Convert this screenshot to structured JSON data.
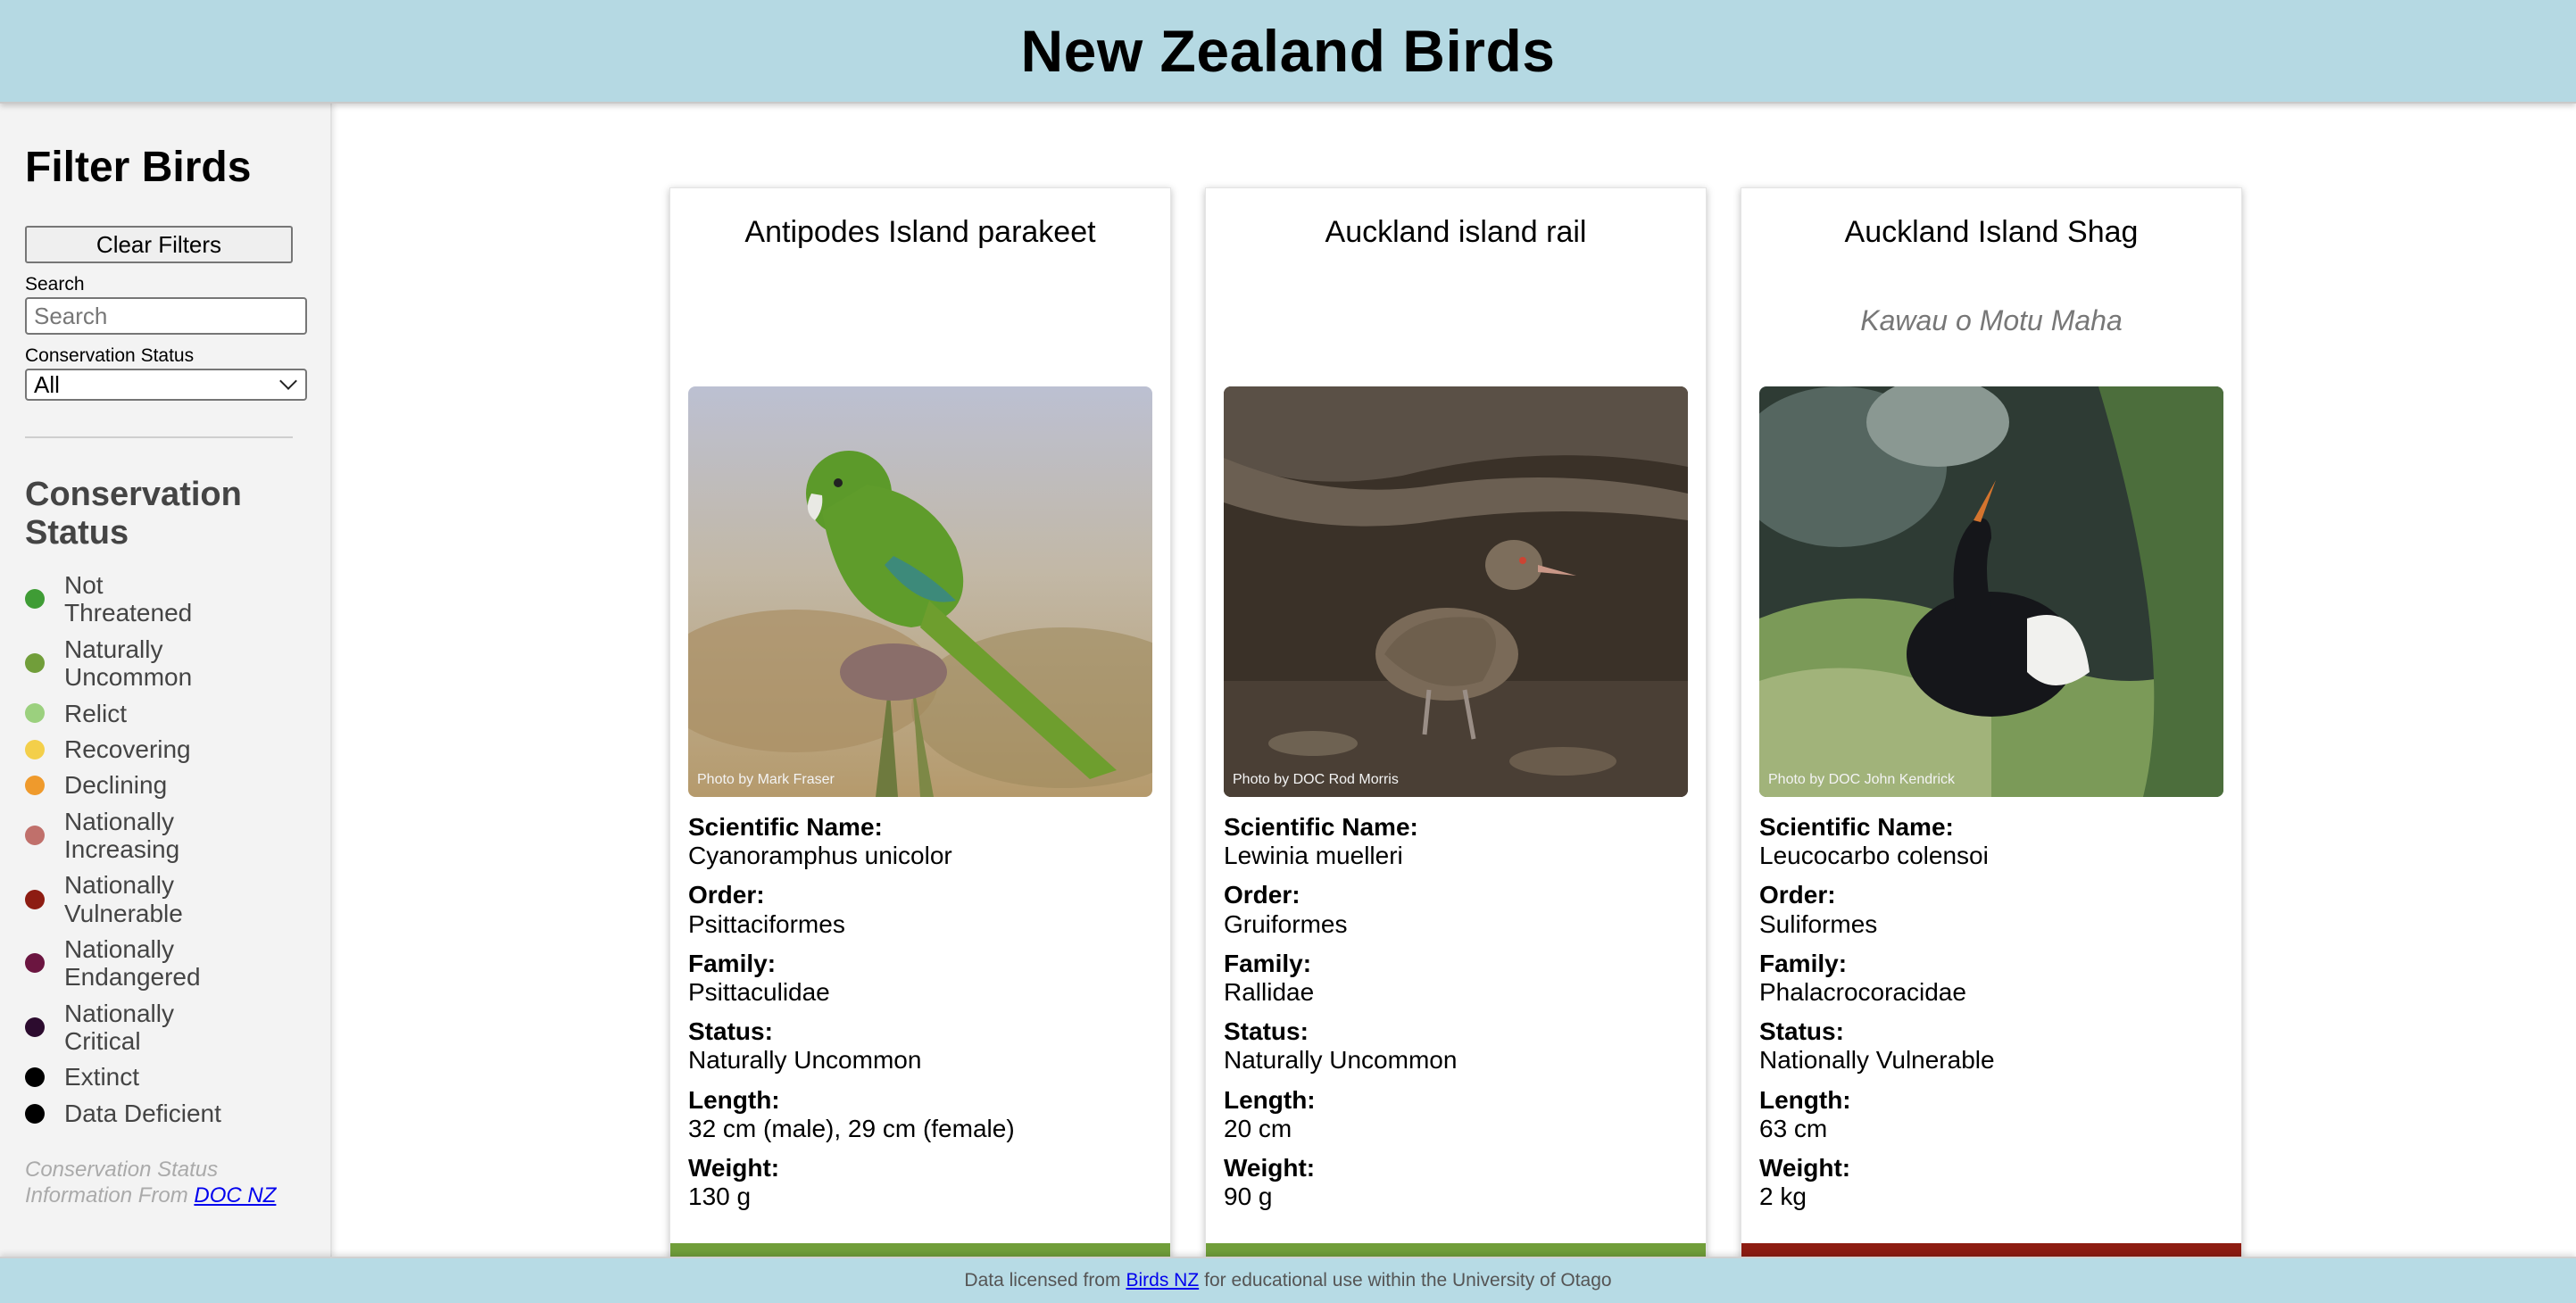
{
  "header": {
    "title": "New Zealand Birds"
  },
  "sidebar": {
    "title": "Filter Birds",
    "clear_label": "Clear Filters",
    "search_label": "Search",
    "search_placeholder": "Search",
    "search_value": "",
    "status_label": "Conservation Status",
    "status_selected": "All",
    "legend_title": "Conservation Status",
    "legend": [
      {
        "label": "Not Threatened",
        "color": "#3f9c35"
      },
      {
        "label": "Naturally Uncommon",
        "color": "#719e3a"
      },
      {
        "label": "Relict",
        "color": "#9bd07e"
      },
      {
        "label": "Recovering",
        "color": "#f3cf4a"
      },
      {
        "label": "Declining",
        "color": "#ef9a2c"
      },
      {
        "label": "Nationally Increasing",
        "color": "#c0706b"
      },
      {
        "label": "Nationally Vulnerable",
        "color": "#8d1c12"
      },
      {
        "label": "Nationally Endangered",
        "color": "#6b1540"
      },
      {
        "label": "Nationally Critical",
        "color": "#2c0b2e"
      },
      {
        "label": "Extinct",
        "color": "#000000"
      },
      {
        "label": "Data Deficient",
        "color": "#000000"
      }
    ],
    "credit_text": "Conservation Status Information From",
    "credit_link": "DOC NZ"
  },
  "cards": [
    {
      "name": "Antipodes Island parakeet",
      "maori_name": "",
      "photo_credit": "Photo by Mark Fraser",
      "photo_icon": "green-parakeet-photo",
      "scientific_label": "Scientific Name:",
      "scientific": "Cyanoramphus unicolor",
      "order_label": "Order:",
      "order": "Psittaciformes",
      "family_label": "Family:",
      "family": "Psittaculidae",
      "status_label": "Status:",
      "status": "Naturally Uncommon",
      "length_label": "Length:",
      "length": "32 cm (male), 29 cm (female)",
      "weight_label": "Weight:",
      "weight": "130 g",
      "status_color": "#719e3a"
    },
    {
      "name": "Auckland island rail",
      "maori_name": "",
      "photo_credit": "Photo by DOC Rod Morris",
      "photo_icon": "rail-bird-photo",
      "scientific_label": "Scientific Name:",
      "scientific": "Lewinia muelleri",
      "order_label": "Order:",
      "order": "Gruiformes",
      "family_label": "Family:",
      "family": "Rallidae",
      "status_label": "Status:",
      "status": "Naturally Uncommon",
      "length_label": "Length:",
      "length": "20 cm",
      "weight_label": "Weight:",
      "weight": "90 g",
      "status_color": "#719e3a"
    },
    {
      "name": "Auckland Island Shag",
      "maori_name": "Kawau o Motu Maha",
      "photo_credit": "Photo by DOC John Kendrick",
      "photo_icon": "shag-bird-photo",
      "scientific_label": "Scientific Name:",
      "scientific": "Leucocarbo colensoi",
      "order_label": "Order:",
      "order": "Suliformes",
      "family_label": "Family:",
      "family": "Phalacrocoracidae",
      "status_label": "Status:",
      "status": "Nationally Vulnerable",
      "length_label": "Length:",
      "length": "63 cm",
      "weight_label": "Weight:",
      "weight": "2 kg",
      "status_color": "#8d1c12"
    }
  ],
  "footer": {
    "text_before": "Data licensed from",
    "link": "Birds NZ",
    "text_after": "for educational use within the University of Otago"
  }
}
